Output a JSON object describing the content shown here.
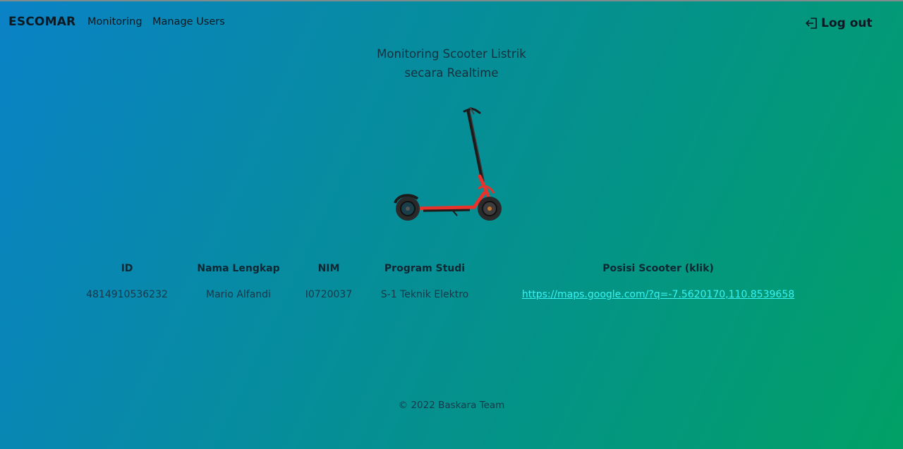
{
  "navbar": {
    "brand": "ESCOMAR",
    "links": [
      "Monitoring",
      "Manage Users"
    ],
    "logout_label": "Log out",
    "logout_icon": "logout-icon"
  },
  "hero": {
    "title_line1": "Monitoring Scooter Listrik",
    "title_line2": "secara Realtime",
    "image": "electric-scooter-image",
    "image_colors": {
      "frame": "#e8322c",
      "stem": "#1b1b1b",
      "tire": "#2a2a2a"
    }
  },
  "table": {
    "headers": [
      "ID",
      "Nama Lengkap",
      "NIM",
      "Program Studi",
      "Posisi Scooter (klik)"
    ],
    "row": {
      "id": "4814910536232",
      "nama": "Mario Alfandi",
      "nim": "I0720037",
      "prodi": "S-1 Teknik Elektro",
      "posisi": "https://maps.google.com/?q=-7.5620170,110.8539658"
    }
  },
  "footer": {
    "text": "© 2022 Baskara Team"
  },
  "colors": {
    "gradient_start": "#0a82c6",
    "gradient_end": "#01a066",
    "link": "#37f4f2"
  }
}
